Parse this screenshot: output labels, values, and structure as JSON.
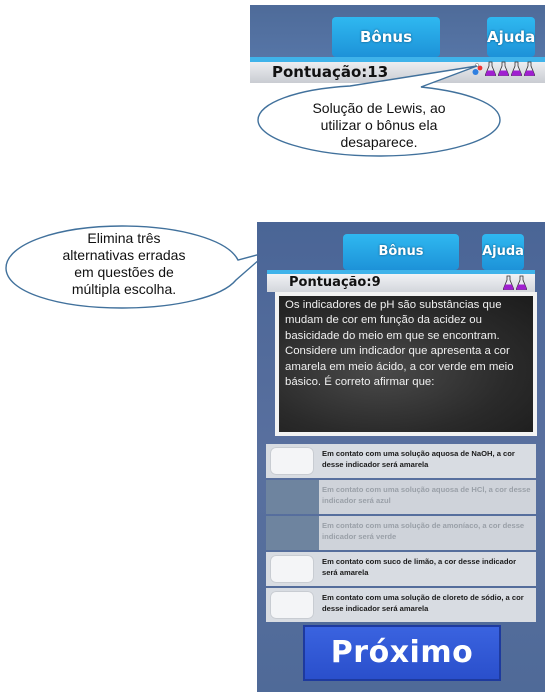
{
  "top_screen": {
    "bonus_label": "Bônus",
    "help_label": "Ajuda",
    "score_text": "Pontuação:13"
  },
  "callout_top": {
    "text": "Solução de Lewis, ao utilizar o bônus ela desaparece."
  },
  "callout_left": {
    "text": "Elimina três alternativas erradas em questões de múltipla escolha."
  },
  "game_screen": {
    "bonus_label": "Bônus",
    "help_label": "Ajuda",
    "score_text": "Pontuação:9",
    "question": "Os indicadores de pH são substâncias que mudam de cor em função da acidez ou basicidade do meio em que se encontram. Considere um indicador que apresenta a cor amarela em meio ácido, a cor verde em meio básico. É correto afirmar que:",
    "answers": [
      {
        "text": "Em contato com uma solução aquosa de NaOH, a cor desse indicador será amarela",
        "eliminated": false
      },
      {
        "text": "Em contato com uma solução aquosa de HCl, a cor desse indicador será azul",
        "eliminated": true
      },
      {
        "text": "Em contato com uma solução de amoníaco, a cor desse indicador será verde",
        "eliminated": true
      },
      {
        "text": "Em contato com suco de limão, a cor desse indicador será amarela",
        "eliminated": false
      },
      {
        "text": "Em contato com uma solução de cloreto de sódio, a cor desse indicador será amarela",
        "eliminated": false
      }
    ],
    "next_label": "Próximo"
  },
  "icons": {
    "flask": "flask-icon",
    "lewis_solution": "lewis-solution-icon"
  },
  "colors": {
    "tab_blue": "#1d92d8",
    "flask_purple": "#a01fd0",
    "next_button": "#2a4fcb"
  }
}
